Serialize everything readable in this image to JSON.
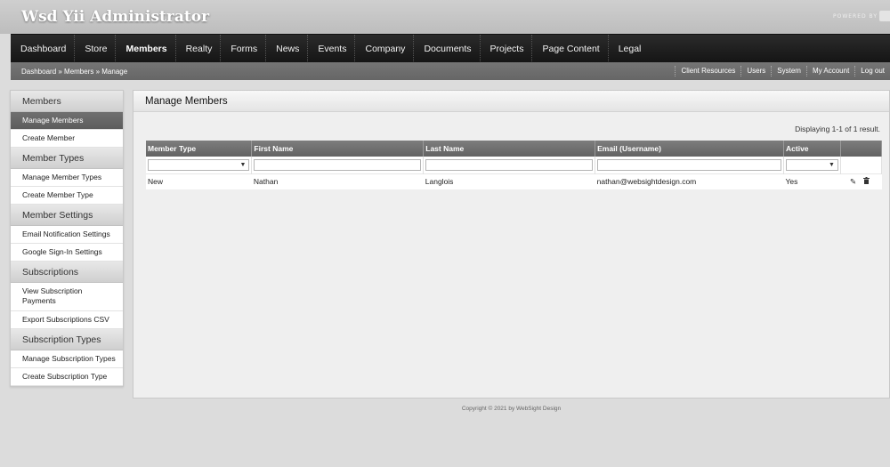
{
  "header": {
    "title": "Wsd Yii Administrator",
    "powered_by": "POWERED BY"
  },
  "main_nav": {
    "items": [
      "Dashboard",
      "Store",
      "Members",
      "Realty",
      "Forms",
      "News",
      "Events",
      "Company",
      "Documents",
      "Projects",
      "Page Content",
      "Legal"
    ],
    "active": "Members"
  },
  "sub_bar": {
    "breadcrumb": "Dashboard » Members » Manage",
    "utility_links": [
      "Client Resources",
      "Users",
      "System",
      "My Account",
      "Log out"
    ]
  },
  "sidebar": {
    "sections": [
      {
        "heading": "Members",
        "items": [
          "Manage Members",
          "Create Member"
        ]
      },
      {
        "heading": "Member Types",
        "items": [
          "Manage Member Types",
          "Create Member Type"
        ]
      },
      {
        "heading": "Member Settings",
        "items": [
          "Email Notification Settings",
          "Google Sign-In Settings"
        ]
      },
      {
        "heading": "Subscriptions",
        "items": [
          "View Subscription Payments",
          "Export Subscriptions CSV"
        ]
      },
      {
        "heading": "Subscription Types",
        "items": [
          "Manage Subscription Types",
          "Create Subscription Type"
        ]
      }
    ],
    "active_item": "Manage Members"
  },
  "panel": {
    "title": "Manage Members",
    "summary": "Displaying 1-1 of 1 result.",
    "columns": [
      "Member Type",
      "First Name",
      "Last Name",
      "Email (Username)",
      "Active"
    ],
    "rows": [
      [
        "New",
        "Nathan",
        "Langlois",
        "nathan@websightdesign.com",
        "Yes"
      ]
    ],
    "action_icons": [
      "pencil-icon",
      "trash-icon"
    ]
  },
  "footer": {
    "copyright": "Copyright © 2021 by WebSight Design"
  }
}
